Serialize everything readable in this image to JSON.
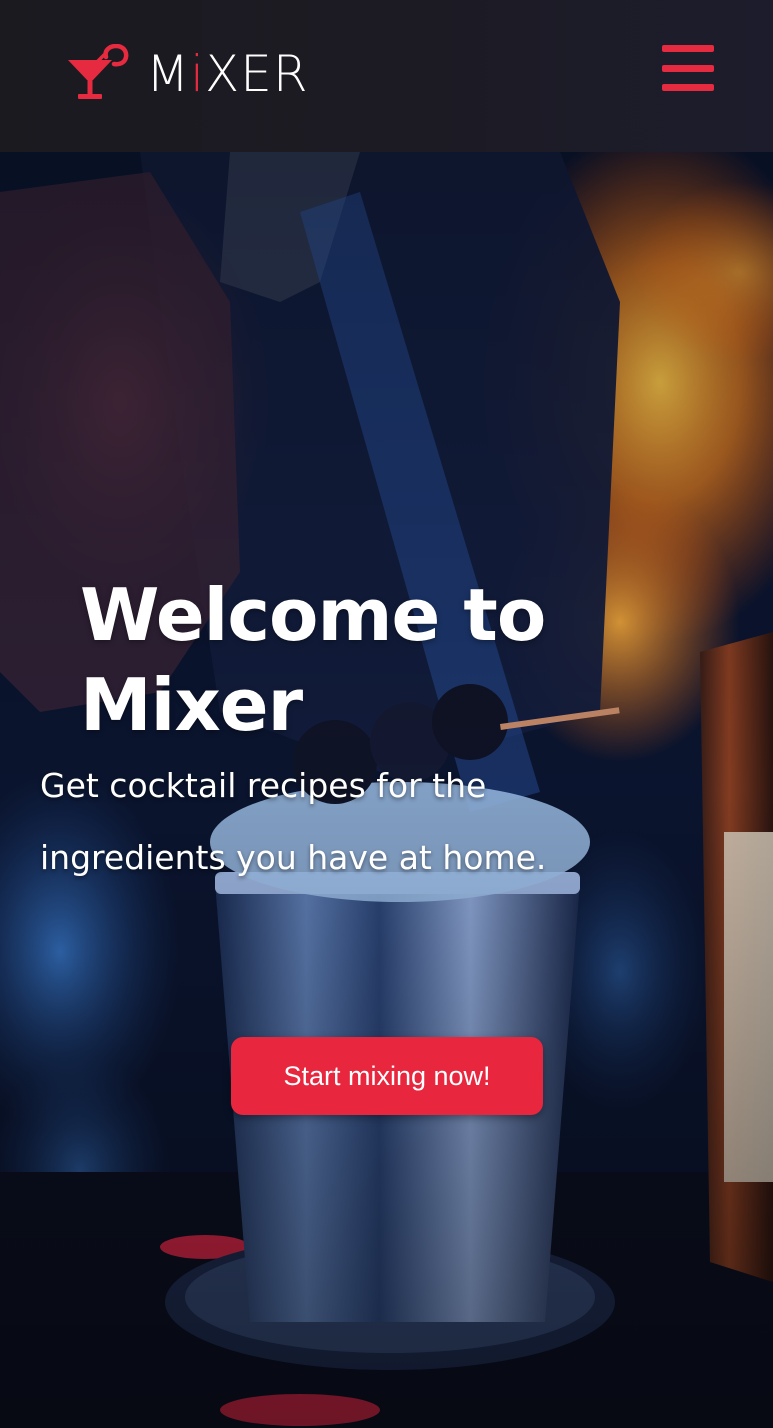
{
  "navbar": {
    "brand_prefix": "M",
    "brand_i": "i",
    "brand_suffix": "XER",
    "logo_icon": "cocktail-glass-icon",
    "menu_icon": "hamburger-menu-icon"
  },
  "hero": {
    "title": "Welcome to Mixer",
    "subtitle": "Get cocktail recipes for the ingredients you have at home.",
    "cta_label": "Start mixing now!"
  },
  "colors": {
    "accent": "#e62a3f",
    "header_bg": "#1c1b24",
    "text": "#ffffff"
  }
}
